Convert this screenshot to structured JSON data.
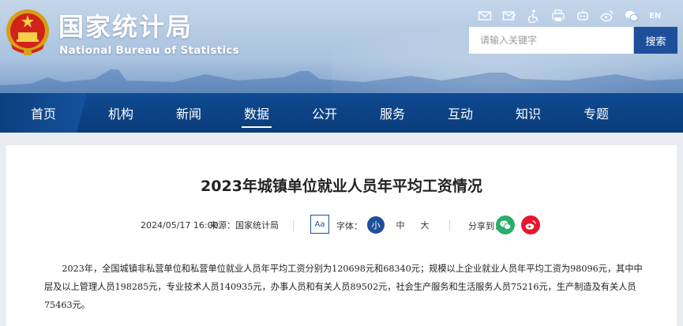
{
  "brand": {
    "name_cn": "国家统计局",
    "name_en": "National Bureau of Statistics"
  },
  "tools": {
    "en_label": "EN"
  },
  "search": {
    "placeholder": "请输入关键字",
    "button_label": "搜索"
  },
  "nav": {
    "items": [
      {
        "label": "首页"
      },
      {
        "label": "机构"
      },
      {
        "label": "新闻"
      },
      {
        "label": "数据",
        "active": true
      },
      {
        "label": "公开"
      },
      {
        "label": "服务"
      },
      {
        "label": "互动"
      },
      {
        "label": "知识"
      },
      {
        "label": "专题"
      }
    ]
  },
  "article": {
    "title": "2023年城镇单位就业人员年平均工资情况",
    "date": "2024/05/17 16:00",
    "source": "来源：国家统计局",
    "aa_label": "Aa",
    "font_label": "字体：",
    "font_sizes": [
      "小",
      "中",
      "大"
    ],
    "share_label": "分享到：",
    "body": "2023年，全国城镇非私营单位和私营单位就业人员年平均工资分别为120698元和68340元；规模以上企业就业人员年平均工资为98096元，其中中层及以上管理人员198285元，专业技术人员140935元，办事人员和有关人员89502元，社会生产服务和生活服务人员75216元，生产制造及有关人员75463元。"
  },
  "colors": {
    "nav_bg": "#0f4a91",
    "accent": "#1e4f9a",
    "wechat": "#2aae67",
    "weibo": "#e6162d"
  }
}
